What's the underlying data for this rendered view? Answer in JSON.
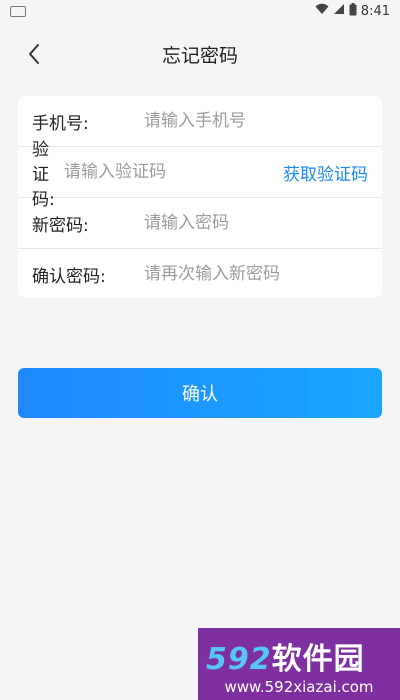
{
  "status_bar": {
    "time": "8:41"
  },
  "nav": {
    "title": "忘记密码"
  },
  "form": {
    "phone": {
      "label": "手机号:",
      "placeholder": "请输入手机号"
    },
    "code": {
      "label": "验证码:",
      "placeholder": "请输入验证码",
      "action": "获取验证码"
    },
    "new_password": {
      "label": "新密码:",
      "placeholder": "请输入密码"
    },
    "confirm_password": {
      "label": "确认密码:",
      "placeholder": "请再次输入新密码"
    }
  },
  "confirm_button": "确认",
  "watermark": {
    "number": "592",
    "name": "软件园",
    "url": "www.592xiazai.com"
  },
  "colors": {
    "accent": "#1a8af5",
    "button_start": "#1e88ff",
    "button_end": "#1aa7ff",
    "background": "#f5f5f7",
    "watermark_bg": "#7e2fa0"
  }
}
